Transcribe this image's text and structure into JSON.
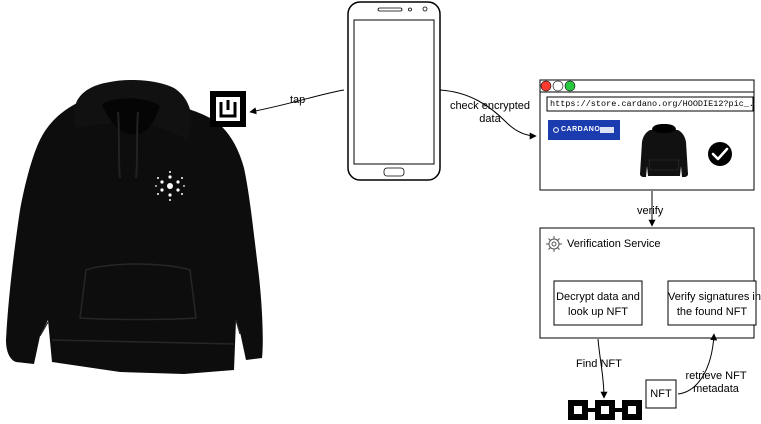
{
  "labels": {
    "tap": "tap",
    "check_line1": "check encrypted",
    "check_line2": "data",
    "verify": "verify",
    "service_title": "Verification Service",
    "decrypt_line1": "Decrypt data and",
    "decrypt_line2": "look up NFT",
    "verify_sig_line1": "Verify signatures in",
    "verify_sig_line2": "the found NFT",
    "find_nft": "Find NFT",
    "retrieve_line1": "retrieve NFT",
    "retrieve_line2": "metadata",
    "nft_box": "NFT"
  },
  "browser": {
    "url": "https://store.cardano.org/HOODIE12?pic_...",
    "brand": "CARDANO"
  },
  "icons": {
    "hoodie": "hoodie-icon",
    "nfc_tag": "nfc-tag-icon",
    "smartphone": "smartphone-icon",
    "check": "check-circle-icon",
    "gear": "gear-icon",
    "blockchain": "blockchain-chain-icon"
  },
  "colors": {
    "hoodie": "#0d0d0d",
    "cardano_blue": "#1a3cae",
    "traffic_red": "#ff3b30",
    "traffic_green": "#28c840"
  }
}
